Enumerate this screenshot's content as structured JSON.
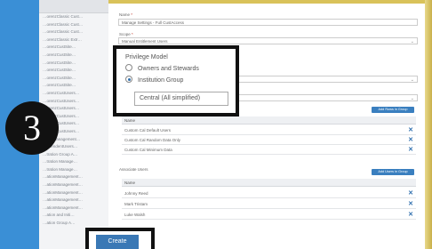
{
  "step_number": "3",
  "sidebar": {
    "items": [
      "…orenzClassic Cust…",
      "…orenzClassic Cust…",
      "…orenzClassic Cust…",
      "…orenzClassic Extr…",
      "…orenzCustSite…",
      "…orenzCustSite…",
      "…orenzCustSite…",
      "…orenzCustSite…",
      "…orenzCustSite…",
      "…orenzCustSite…",
      "…orenzCustUsers…",
      "…orenzCustUsers…",
      "…orenzCustUsers…",
      "…orenzCustUsers…",
      "…orenzCustUsers…",
      "…orenzCustUsers…",
      "…ice Management…",
      "…intendentUsers…",
      "…tration Group A…",
      "…tration Manage…",
      "…tration Manage…",
      "…ationManagement…",
      "…ationManagement…",
      "…ationManagement…",
      "…ationManagement…",
      "…ationManagement…",
      "…ation and Initi…",
      "…ation Group A…"
    ]
  },
  "form": {
    "name_label": "Name",
    "name_value": "Manage Settings - Full CustAccess",
    "scope_label": "Scope",
    "scope_value": "Manual Entitlement Users",
    "required_marker": "*"
  },
  "privilege_popup": {
    "title": "Privilege Model",
    "options": [
      "Owners and Stewards",
      "Institution Group"
    ],
    "selected_index": 1,
    "institution_value": "Central (All simplified)"
  },
  "groups": {
    "add_button": "Add Rows in Group",
    "header": "Name",
    "rows": [
      "Custom Cal Default Users",
      "Custom Cal Random Data Only",
      "Custom Cal Minimum Data"
    ]
  },
  "users": {
    "section_label": "Associate Users",
    "add_button": "Add Users in Group",
    "header": "Name",
    "rows": [
      "Johnny Reed",
      "Mark Tristam",
      "Luke Walsh"
    ]
  },
  "actions": {
    "create_label": "Create"
  }
}
